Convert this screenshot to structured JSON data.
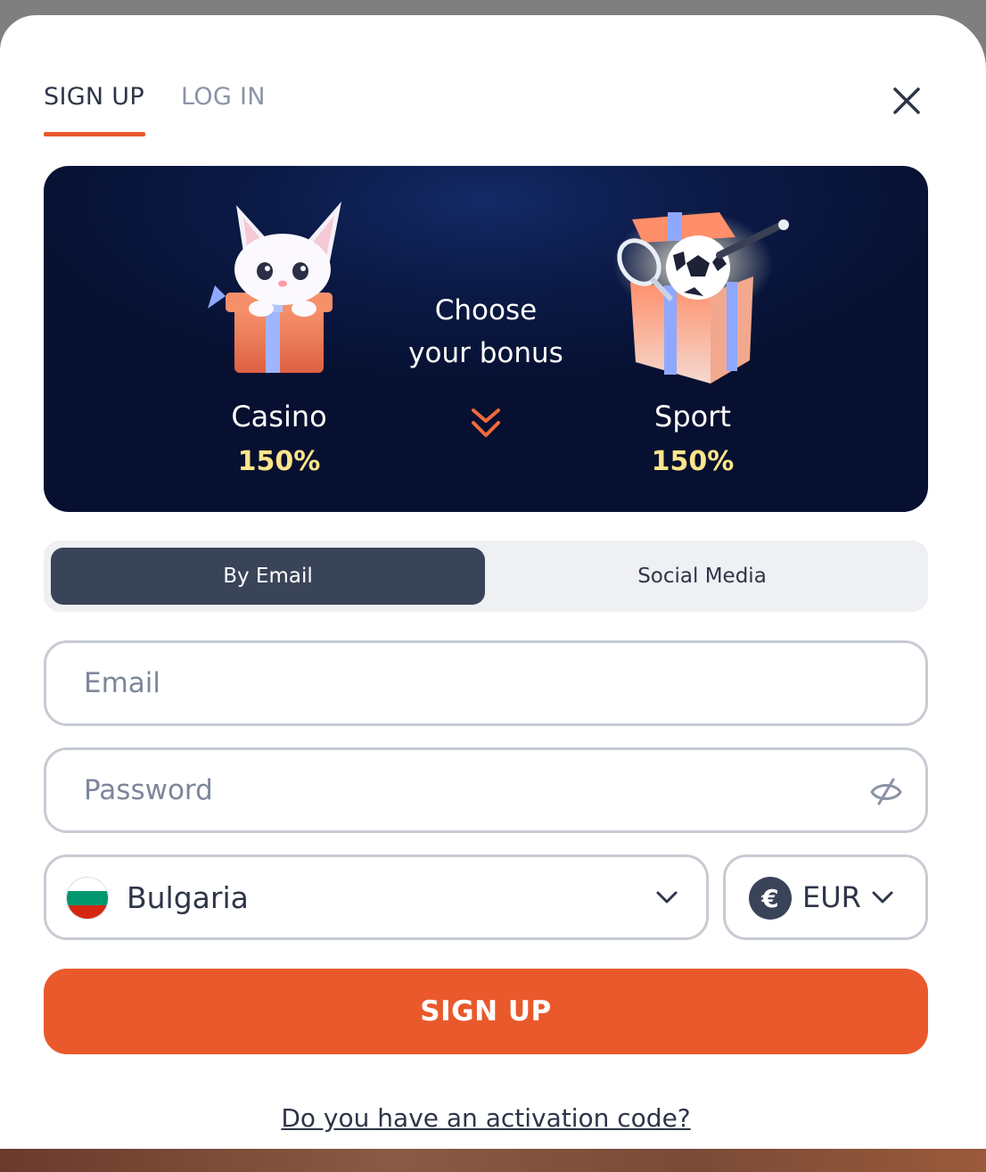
{
  "tabs": {
    "signup": "SIGN UP",
    "login": "LOG IN"
  },
  "banner": {
    "headline_line1": "Choose",
    "headline_line2": "your bonus",
    "casino": {
      "name": "Casino",
      "percent": "150%"
    },
    "sport": {
      "name": "Sport",
      "percent": "150%"
    }
  },
  "method": {
    "email": "By Email",
    "social": "Social Media"
  },
  "form": {
    "email_placeholder": "Email",
    "password_placeholder": "Password",
    "country": "Bulgaria",
    "currency_symbol": "€",
    "currency": "EUR"
  },
  "signup_button": "SIGN UP",
  "activation_link": "Do you have an activation code?",
  "colors": {
    "accent": "#e9592b",
    "dark": "#3a4459",
    "bonus_yellow": "#ffe58a",
    "banner_bg": "#0b1a47"
  },
  "icons": {
    "close": "close-icon",
    "arrows": "double-chevron-down-icon",
    "eye": "eye-off-icon",
    "chevron": "chevron-down-icon",
    "euro": "euro-icon",
    "flag": "bulgaria-flag-icon"
  }
}
